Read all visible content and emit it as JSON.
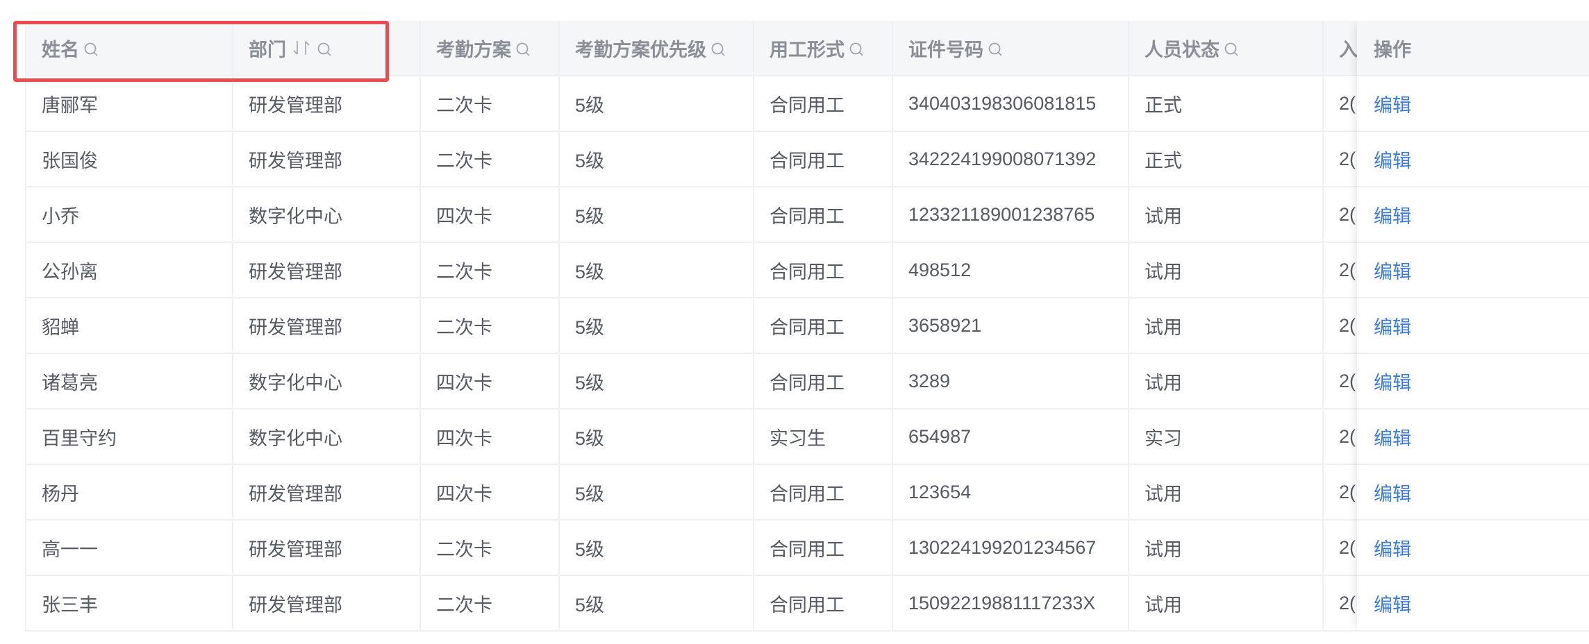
{
  "table": {
    "columns": [
      "姓名",
      "部门",
      "考勤方案",
      "考勤方案优先级",
      "用工形式",
      "证件号码",
      "人员状态",
      "入"
    ],
    "action_column": "操作",
    "rows": [
      [
        "唐郦军",
        "研发管理部",
        "二次卡",
        "5级",
        "合同用工",
        "340403198306081815",
        "正式",
        "2("
      ],
      [
        "张国俊",
        "研发管理部",
        "二次卡",
        "5级",
        "合同用工",
        "342224199008071392",
        "正式",
        "2("
      ],
      [
        "小乔",
        "数字化中心",
        "四次卡",
        "5级",
        "合同用工",
        "123321189001238765",
        "试用",
        "2("
      ],
      [
        "公孙离",
        "研发管理部",
        "二次卡",
        "5级",
        "合同用工",
        "498512",
        "试用",
        "2("
      ],
      [
        "貂蝉",
        "研发管理部",
        "二次卡",
        "5级",
        "合同用工",
        "3658921",
        "试用",
        "2("
      ],
      [
        "诸葛亮",
        "数字化中心",
        "四次卡",
        "5级",
        "合同用工",
        "3289",
        "试用",
        "2("
      ],
      [
        "百里守约",
        "数字化中心",
        "四次卡",
        "5级",
        "实习生",
        "654987",
        "实习",
        "2("
      ],
      [
        "杨丹",
        "研发管理部",
        "四次卡",
        "5级",
        "合同用工",
        "123654",
        "试用",
        "2("
      ],
      [
        "高一一",
        "研发管理部",
        "二次卡",
        "5级",
        "合同用工",
        "130224199201234567",
        "试用",
        "2("
      ],
      [
        "张三丰",
        "研发管理部",
        "二次卡",
        "5级",
        "合同用工",
        "15092219881117233X",
        "试用",
        "2("
      ]
    ],
    "edit_label": "编辑"
  },
  "icons": {
    "search": "search-icon",
    "sort": "sort-icon"
  },
  "colors": {
    "link": "#3a7bd5",
    "highlight": "#ee4b4f",
    "header_bg": "#f5f6f8"
  }
}
